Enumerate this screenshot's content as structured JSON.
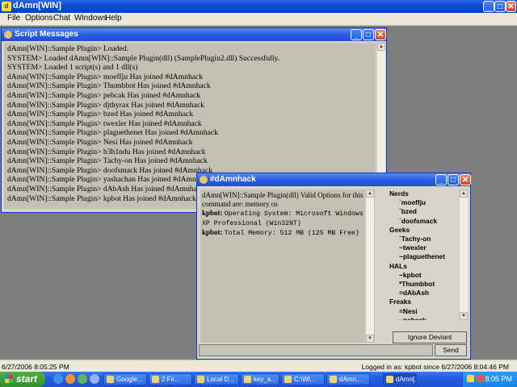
{
  "app": {
    "title": "dAmn[WIN]"
  },
  "menu": [
    "File",
    "Options",
    "Chat",
    "Windows",
    "Help"
  ],
  "script_window": {
    "title": "Script Messages",
    "lines": [
      "dAmn[WIN]::Sample Plugin> Loaded.",
      "SYSTEM> Loaded dAmn[WIN]::Sample Plugin(dll) (SamplePlugin2.dll) Successfully.",
      "SYSTEM> Loaded 1 script(s) and 1 dll(s)",
      "dAmn[WIN]::Sample Plugin> moeffju Has joined #dAmnhack",
      "dAmn[WIN]::Sample Plugin> Thumbbot Has joined #dAmnhack",
      "dAmn[WIN]::Sample Plugin> pebcak Has joined #dAmnhack",
      "dAmn[WIN]::Sample Plugin> djthyrax Has joined #dAmnhack",
      "dAmn[WIN]::Sample Plugin> bzed Has joined #dAmnhack",
      "dAmn[WIN]::Sample Plugin> twexler Has joined #dAmnhack",
      "dAmn[WIN]::Sample Plugin> plaguethenet Has joined #dAmnhack",
      "dAmn[WIN]::Sample Plugin> Nesi Has joined #dAmnhack",
      "dAmn[WIN]::Sample Plugin> b3h1ndu Has joined #dAmnhack",
      "dAmn[WIN]::Sample Plugin> Tachy-on Has joined #dAmnhack",
      "dAmn[WIN]::Sample Plugin> doofsmack Has joined #dAmnhack",
      "dAmn[WIN]::Sample Plugin> yashachan Has joined #dAmnhack",
      "dAmn[WIN]::Sample Plugin> dAbAsh Has joined #dAmnhack",
      "dAmn[WIN]::Sample Plugin> kpbot Has joined #dAmnhack"
    ]
  },
  "chat_window": {
    "title": "#dAmnhack",
    "messages": {
      "m1_text": "dAmn[WIN]::Sample Plugin(dll) Valid Options for this command are: memory os",
      "m2_nick": "kpbot:",
      "m2_text": "Operating System: Microsoft Windows XP Professional (Win32NT)",
      "m3_nick": "kpbot:",
      "m3_text": "Total Memory: 512 MB (125 MB Free)"
    },
    "userlist": [
      {
        "group": "Nerds",
        "users": [
          "`moeffju",
          "`bzed",
          "`doofsmack"
        ]
      },
      {
        "group": "Geeks",
        "users": [
          "`Tachy-on",
          "~twexler",
          "~plaguethenet"
        ]
      },
      {
        "group": "HALs",
        "users": [
          "~kpbot",
          "*Thumbbot",
          "=dAbAsh"
        ]
      },
      {
        "group": "Freaks",
        "users": [
          "=Nesi",
          "~pebcak"
        ]
      }
    ],
    "ignore_button": "Ignore Deviant",
    "send_button": "Send"
  },
  "status": {
    "left": "6/27/2006 8:05:25 PM",
    "right": "Logged in as: kpbot since 6/27/2006 8:04:46 PM"
  },
  "taskbar": {
    "start": "start",
    "tasks": [
      "Google...",
      "2 Fir...",
      "Local D...",
      "key_a...",
      "C:\\WI...",
      "dAmn...",
      "dAmn[..."
    ],
    "clock": "8:05 PM"
  }
}
